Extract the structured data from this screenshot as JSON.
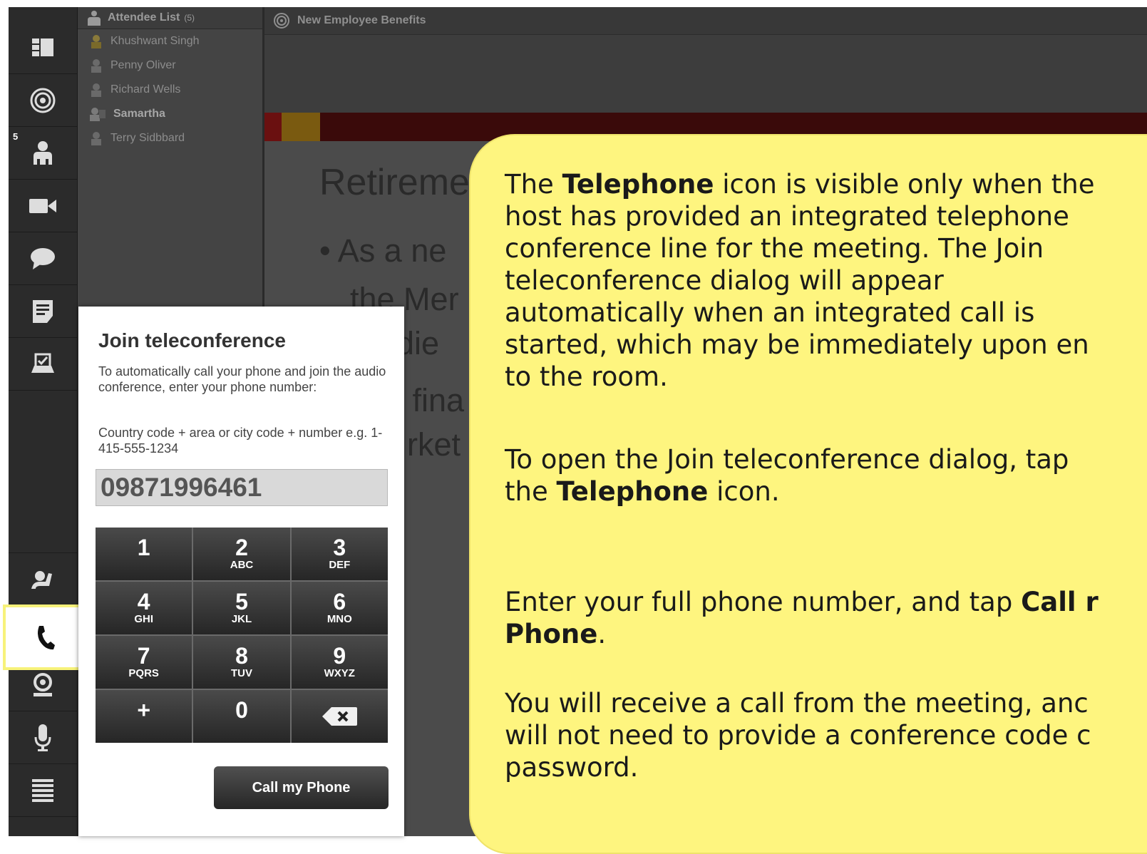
{
  "sidebar": {
    "attendee_badge": "5",
    "icons": [
      "layout-icon",
      "share-target-icon",
      "attendees-icon",
      "camera-icon",
      "chat-icon",
      "notes-icon",
      "poll-icon",
      "raise-hand-icon",
      "telephone-icon",
      "webcam-icon",
      "microphone-icon",
      "menu-icon"
    ]
  },
  "attendee_pod": {
    "title": "Attendee List",
    "count": "(5)",
    "attendees": [
      {
        "name": "Khushwant Singh"
      },
      {
        "name": "Penny Oliver"
      },
      {
        "name": "Richard Wells"
      },
      {
        "name": "Samartha"
      },
      {
        "name": "Terry Sidbbard"
      }
    ]
  },
  "share_pod": {
    "title": "New Employee Benefits",
    "slide_title": "Retireme",
    "slide_lines": [
      "• As a ne",
      "the Mer",
      "ridie",
      "e fina",
      "rket"
    ]
  },
  "dialog": {
    "title": "Join teleconference",
    "instructions": "To automatically call your phone and join the audio conference, enter your phone number:",
    "format_hint": "Country code + area or city code + number e.g. 1-415-555-1234",
    "phone_value": "09871996461",
    "keys": [
      {
        "digit": "1",
        "letters": ""
      },
      {
        "digit": "2",
        "letters": "ABC"
      },
      {
        "digit": "3",
        "letters": "DEF"
      },
      {
        "digit": "4",
        "letters": "GHI"
      },
      {
        "digit": "5",
        "letters": "JKL"
      },
      {
        "digit": "6",
        "letters": "MNO"
      },
      {
        "digit": "7",
        "letters": "PQRS"
      },
      {
        "digit": "8",
        "letters": "TUV"
      },
      {
        "digit": "9",
        "letters": "WXYZ"
      },
      {
        "digit": "+",
        "letters": ""
      },
      {
        "digit": "0",
        "letters": ""
      },
      {
        "digit": "",
        "letters": ""
      }
    ],
    "call_button": "Call my Phone"
  },
  "callout": {
    "para1": [
      [
        "The ",
        "Telephone",
        " icon is visible only when the"
      ],
      [
        "host has provided an integrated telephone"
      ],
      [
        "conference line for the meeting. The Join"
      ],
      [
        "teleconference dialog will appear"
      ],
      [
        "automatically when an integrated call is"
      ],
      [
        "started, which may be immediately upon en"
      ],
      [
        "to the room."
      ]
    ],
    "para2": [
      [
        "To open the Join teleconference dialog, tap"
      ],
      [
        "the ",
        "Telephone",
        " icon."
      ]
    ],
    "para3": [
      [
        "Enter your full phone number, and tap ",
        "Call r"
      ],
      [
        "",
        "Phone",
        "."
      ]
    ],
    "para4": [
      [
        "You will receive a call from the meeting, anc"
      ],
      [
        "will not need to provide a conference code c"
      ],
      [
        "password."
      ]
    ]
  },
  "colors": {
    "highlight": "#f7f27a",
    "callout": "#fef57f"
  }
}
